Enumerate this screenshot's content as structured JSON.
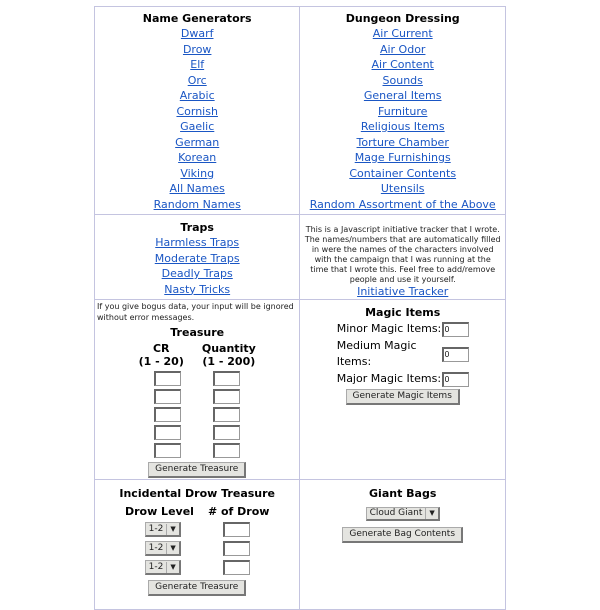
{
  "name_generators": {
    "title": "Name Generators",
    "links": [
      "Dwarf",
      "Drow",
      "Elf",
      "Orc",
      "Arabic",
      "Cornish",
      "Gaelic",
      "German",
      "Korean",
      "Viking",
      "All Names",
      "Random Names"
    ]
  },
  "dungeon_dressing": {
    "title": "Dungeon Dressing",
    "links": [
      "Air Current",
      "Air Odor",
      "Air Content",
      "Sounds",
      "General Items",
      "Furniture",
      "Religious Items",
      "Torture Chamber",
      "Mage Furnishings",
      "Container Contents",
      "Utensils",
      "Random Assortment of the Above"
    ]
  },
  "traps": {
    "title": "Traps",
    "links": [
      "Harmless Traps",
      "Moderate Traps",
      "Deadly Traps",
      "Nasty Tricks"
    ]
  },
  "initiative": {
    "description": "This is a Javascript initiative tracker that I wrote. The names/numbers that are automatically filled in were the names of the characters involved with the campaign that I was running at the time that I wrote this. Feel free to add/remove people and use it yourself.",
    "link": "Initiative Tracker"
  },
  "treasure": {
    "note": "If you give bogus data, your input will be ignored without error messages.",
    "title": "Treasure",
    "col1_header": "CR",
    "col1_range": "(1 - 20)",
    "col2_header": "Quantity",
    "col2_range": "(1 - 200)",
    "rows": [
      {
        "cr": "",
        "qty": ""
      },
      {
        "cr": "",
        "qty": ""
      },
      {
        "cr": "",
        "qty": ""
      },
      {
        "cr": "",
        "qty": ""
      },
      {
        "cr": "",
        "qty": ""
      }
    ],
    "button": "Generate Treasure"
  },
  "magic_items": {
    "title": "Magic Items",
    "fields": [
      {
        "label": "Minor Magic Items:",
        "value": "0"
      },
      {
        "label": "Medium Magic Items:",
        "value": "0"
      },
      {
        "label": "Major Magic Items:",
        "value": "0"
      }
    ],
    "button": "Generate Magic Items"
  },
  "drow_treasure": {
    "title": "Incidental Drow Treasure",
    "col1_header": "Drow Level",
    "col2_header": "# of Drow",
    "rows": [
      {
        "level": "1-2",
        "count": ""
      },
      {
        "level": "1-2",
        "count": ""
      },
      {
        "level": "1-2",
        "count": ""
      }
    ],
    "button": "Generate Treasure"
  },
  "giant_bags": {
    "title": "Giant Bags",
    "selected": "Cloud Giant",
    "button": "Generate Bag Contents"
  }
}
